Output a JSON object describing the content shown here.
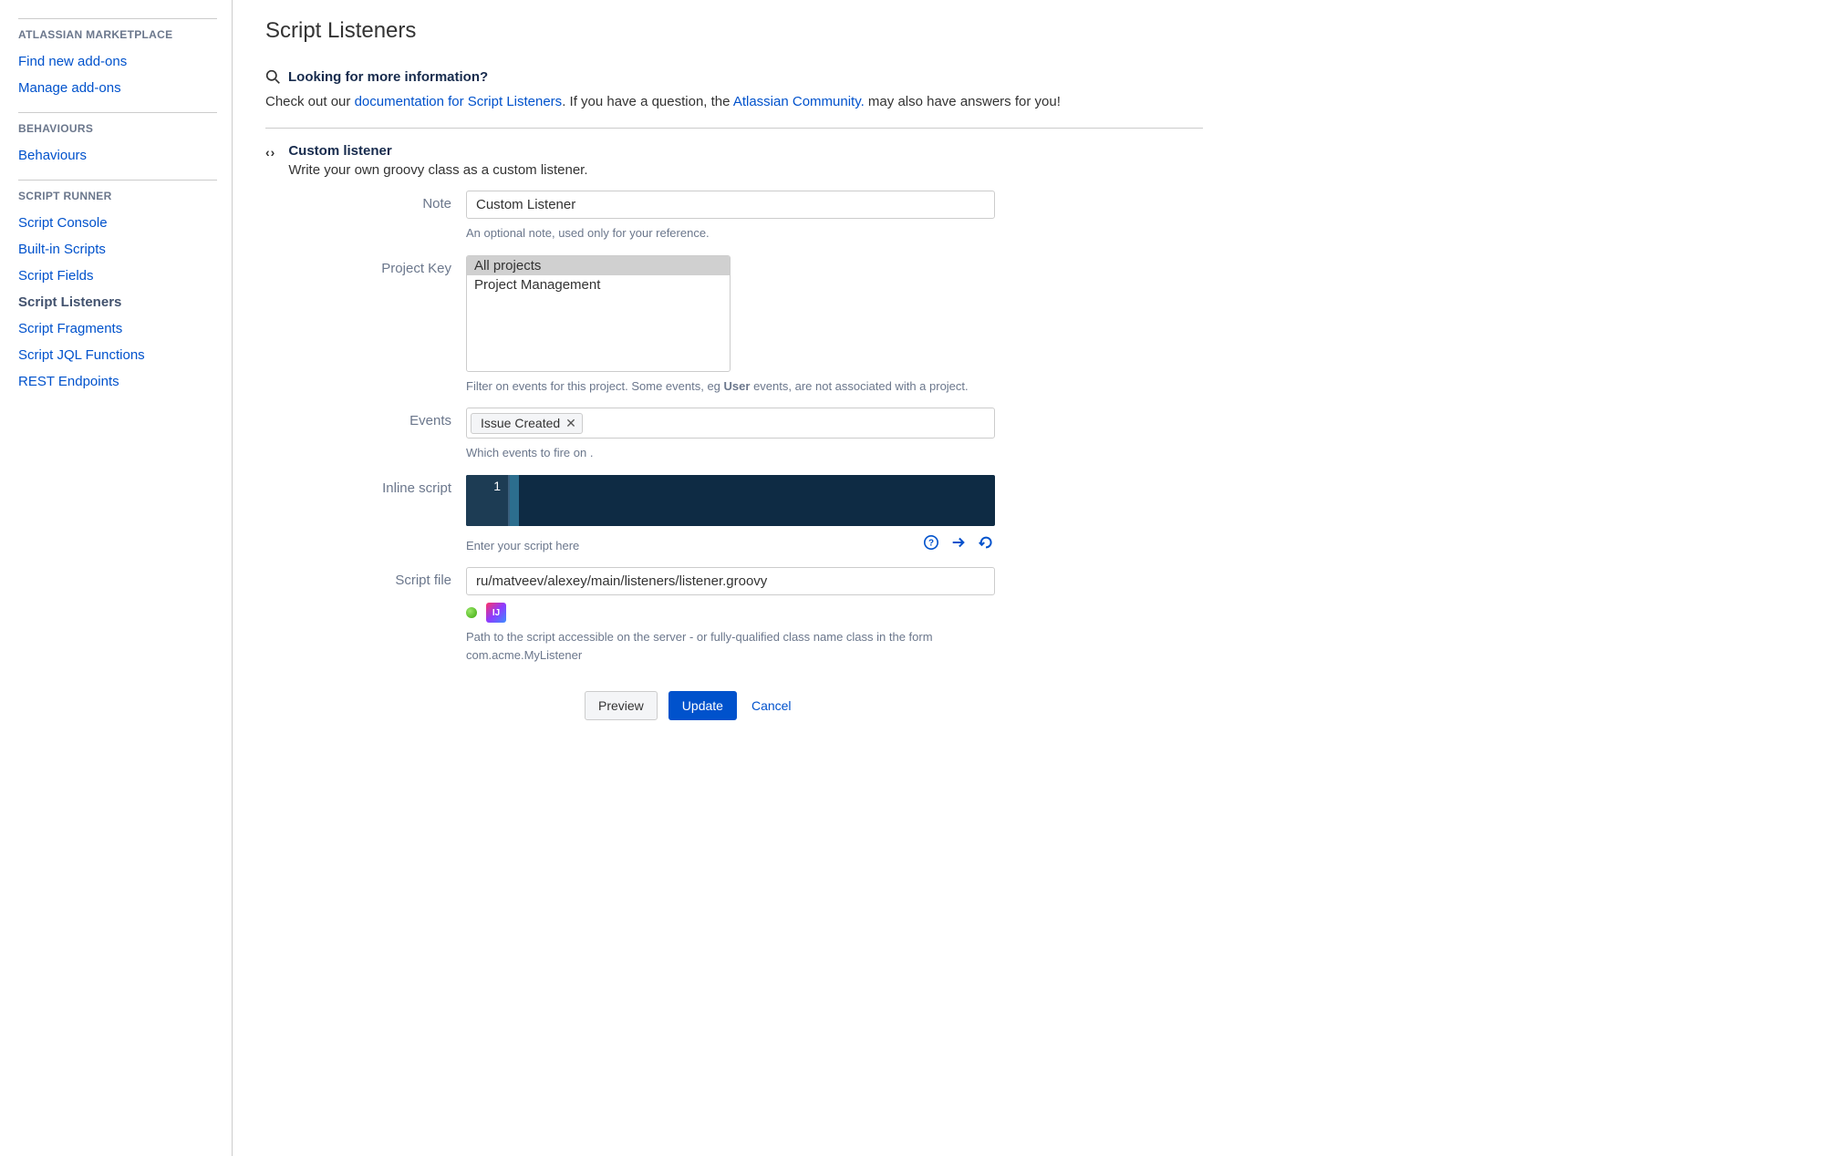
{
  "sidebar": {
    "sections": [
      {
        "heading": "ATLASSIAN MARKETPLACE",
        "items": [
          {
            "label": "Find new add-ons",
            "name": "find-new-addons"
          },
          {
            "label": "Manage add-ons",
            "name": "manage-addons"
          }
        ]
      },
      {
        "heading": "BEHAVIOURS",
        "items": [
          {
            "label": "Behaviours",
            "name": "behaviours"
          }
        ]
      },
      {
        "heading": "SCRIPT RUNNER",
        "items": [
          {
            "label": "Script Console",
            "name": "script-console"
          },
          {
            "label": "Built-in Scripts",
            "name": "built-in-scripts"
          },
          {
            "label": "Script Fields",
            "name": "script-fields"
          },
          {
            "label": "Script Listeners",
            "name": "script-listeners",
            "active": true
          },
          {
            "label": "Script Fragments",
            "name": "script-fragments"
          },
          {
            "label": "Script JQL Functions",
            "name": "script-jql-functions"
          },
          {
            "label": "REST Endpoints",
            "name": "rest-endpoints"
          }
        ]
      }
    ]
  },
  "page": {
    "title": "Script Listeners"
  },
  "info": {
    "title": "Looking for more information?",
    "pre": "Check out our ",
    "link1": "documentation for Script Listeners",
    "mid": ". If you have a question, the ",
    "link2": "Atlassian Community.",
    "post": " may also have answers for you!"
  },
  "formHeader": {
    "title": "Custom listener",
    "desc": "Write your own groovy class as a custom listener."
  },
  "note": {
    "label": "Note",
    "value": "Custom Listener",
    "helper": "An optional note, used only for your reference."
  },
  "projectKey": {
    "label": "Project Key",
    "options": [
      {
        "text": "All projects",
        "selected": true
      },
      {
        "text": "Project Management",
        "selected": false
      }
    ],
    "helper_pre": "Filter on events for this project. Some events, eg ",
    "helper_strong": "User",
    "helper_post": " events, are not associated with a project."
  },
  "events": {
    "label": "Events",
    "tags": [
      "Issue Created"
    ],
    "helper": "Which events to fire on ."
  },
  "inlineScript": {
    "label": "Inline script",
    "gutter": "1",
    "helper": "Enter your script here"
  },
  "scriptFile": {
    "label": "Script file",
    "value": "ru/matveev/alexey/main/listeners/listener.groovy",
    "helper": "Path to the script accessible on the server - or fully-qualified class name class in the form com.acme.MyListener"
  },
  "buttons": {
    "preview": "Preview",
    "update": "Update",
    "cancel": "Cancel"
  }
}
